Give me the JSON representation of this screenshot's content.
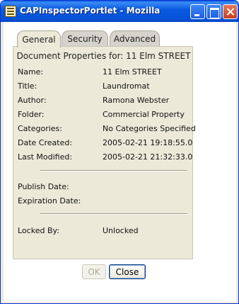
{
  "window": {
    "title": "CAPInspectorPortlet - Mozilla"
  },
  "tabs": [
    {
      "label": "General",
      "active": true
    },
    {
      "label": "Security",
      "active": false
    },
    {
      "label": "Advanced",
      "active": false
    }
  ],
  "panel": {
    "heading": "Document Properties for: 11 Elm STREET",
    "properties": [
      {
        "label": "Name:",
        "value": "11 Elm STREET"
      },
      {
        "label": "Title:",
        "value": "Laundromat"
      },
      {
        "label": "Author:",
        "value": "Ramona Webster"
      },
      {
        "label": "Folder:",
        "value": "Commercial Property"
      },
      {
        "label": "Categories:",
        "value": "No Categories Specified"
      },
      {
        "label": "Date Created:",
        "value": "2005-02-21 19:18:55.0"
      },
      {
        "label": "Last Modified:",
        "value": "2005-02-21 21:32:33.0"
      }
    ],
    "dates": [
      {
        "label": "Publish Date:",
        "value": ""
      },
      {
        "label": "Expiration Date:",
        "value": ""
      }
    ],
    "lock": {
      "label": "Locked By:",
      "value": "Unlocked"
    }
  },
  "buttons": {
    "ok_label": "OK",
    "ok_enabled": false,
    "close_label": "Close"
  },
  "colors": {
    "titlebar": "#0553d8",
    "panel_bg": "#ece9d8",
    "close_button": "#c5401f"
  }
}
